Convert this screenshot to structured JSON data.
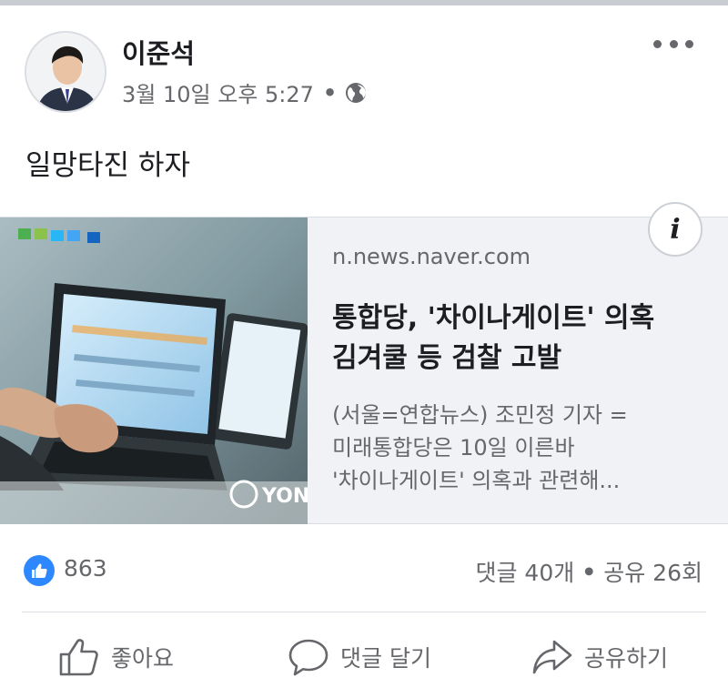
{
  "post": {
    "author": "이준석",
    "timestamp": "3월 10일 오후 5:27",
    "separator": "•",
    "privacy_icon": "globe-icon",
    "text": "일망타진 하자"
  },
  "link_card": {
    "domain": "n.news.naver.com",
    "headline_line1": "통합당, '차이나게이트' 의혹",
    "headline_line2": "김겨쿨 등 검찰 고발",
    "desc_line1": "(서울=연합뉴스) 조민정 기자 =",
    "desc_line2": "미래통합당은 10일 이른바",
    "desc_line3": "'차이나게이트' 의혹과 관련해...",
    "info_label": "i",
    "thumb_watermark": "YON"
  },
  "stats": {
    "like_count": "863",
    "comments": "댓글 40개",
    "separator": "•",
    "shares": "공유 26회"
  },
  "actions": {
    "like": "좋아요",
    "comment": "댓글 달기",
    "share": "공유하기"
  },
  "colors": {
    "accent": "#2d88ff",
    "meta_text": "#65676b",
    "card_bg": "#f0f2f5"
  }
}
